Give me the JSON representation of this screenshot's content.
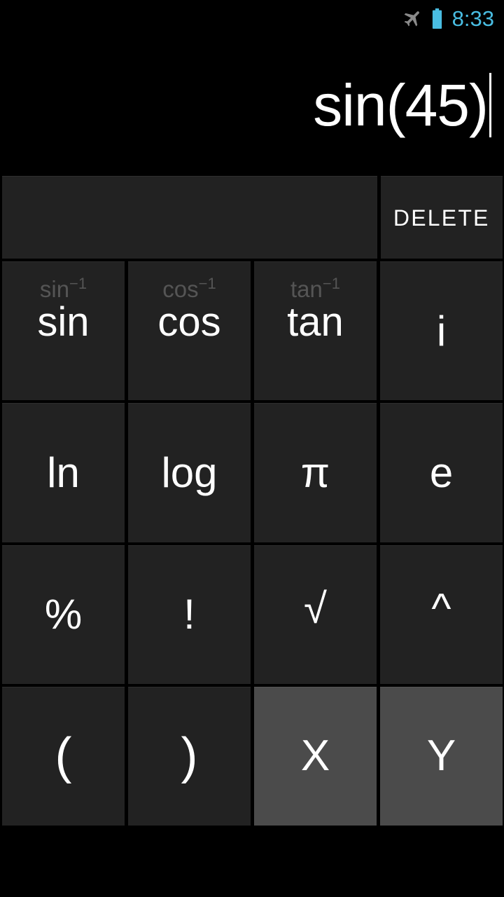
{
  "status_bar": {
    "airplane_icon": "airplane-mode-icon",
    "battery_icon": "battery-icon",
    "time": "8:33",
    "accent_color": "#49bde2",
    "icon_gray": "#8a8a8a"
  },
  "display": {
    "expression": "sin(45)",
    "caret_visible": true,
    "text_color": "#ffffff",
    "background": "#000000"
  },
  "keypad": {
    "key_background": "#222222",
    "variable_key_background": "#4b4b4b",
    "key_text_color": "#ffffff",
    "inverse_label_color": "#555555",
    "rows": [
      {
        "name": "row-delete",
        "keys": [
          {
            "name": "blank-key",
            "label": "",
            "type": "blank"
          },
          {
            "name": "delete-key",
            "label": "DELETE",
            "type": "text"
          }
        ]
      },
      {
        "name": "row-trig",
        "keys": [
          {
            "name": "sin-key",
            "label": "sin",
            "inverse": "sin",
            "inverse_exp": "−1",
            "type": "trig"
          },
          {
            "name": "cos-key",
            "label": "cos",
            "inverse": "cos",
            "inverse_exp": "−1",
            "type": "trig"
          },
          {
            "name": "tan-key",
            "label": "tan",
            "inverse": "tan",
            "inverse_exp": "−1",
            "type": "trig"
          },
          {
            "name": "imaginary-key",
            "label": "i",
            "type": "symbol"
          }
        ]
      },
      {
        "name": "row-logs",
        "keys": [
          {
            "name": "ln-key",
            "label": "ln",
            "type": "symbol"
          },
          {
            "name": "log-key",
            "label": "log",
            "type": "symbol"
          },
          {
            "name": "pi-key",
            "label": "π",
            "type": "symbol"
          },
          {
            "name": "euler-key",
            "label": "e",
            "type": "symbol"
          }
        ]
      },
      {
        "name": "row-operators",
        "keys": [
          {
            "name": "percent-key",
            "label": "%",
            "type": "symbol"
          },
          {
            "name": "factorial-key",
            "label": "!",
            "type": "symbol"
          },
          {
            "name": "sqrt-key",
            "label": "√",
            "type": "symbol"
          },
          {
            "name": "power-key",
            "label": "^",
            "type": "symbol"
          }
        ]
      },
      {
        "name": "row-parens-vars",
        "keys": [
          {
            "name": "open-paren-key",
            "label": "(",
            "type": "paren"
          },
          {
            "name": "close-paren-key",
            "label": ")",
            "type": "paren"
          },
          {
            "name": "variable-x-key",
            "label": "X",
            "type": "variable"
          },
          {
            "name": "variable-y-key",
            "label": "Y",
            "type": "variable"
          }
        ]
      }
    ]
  }
}
